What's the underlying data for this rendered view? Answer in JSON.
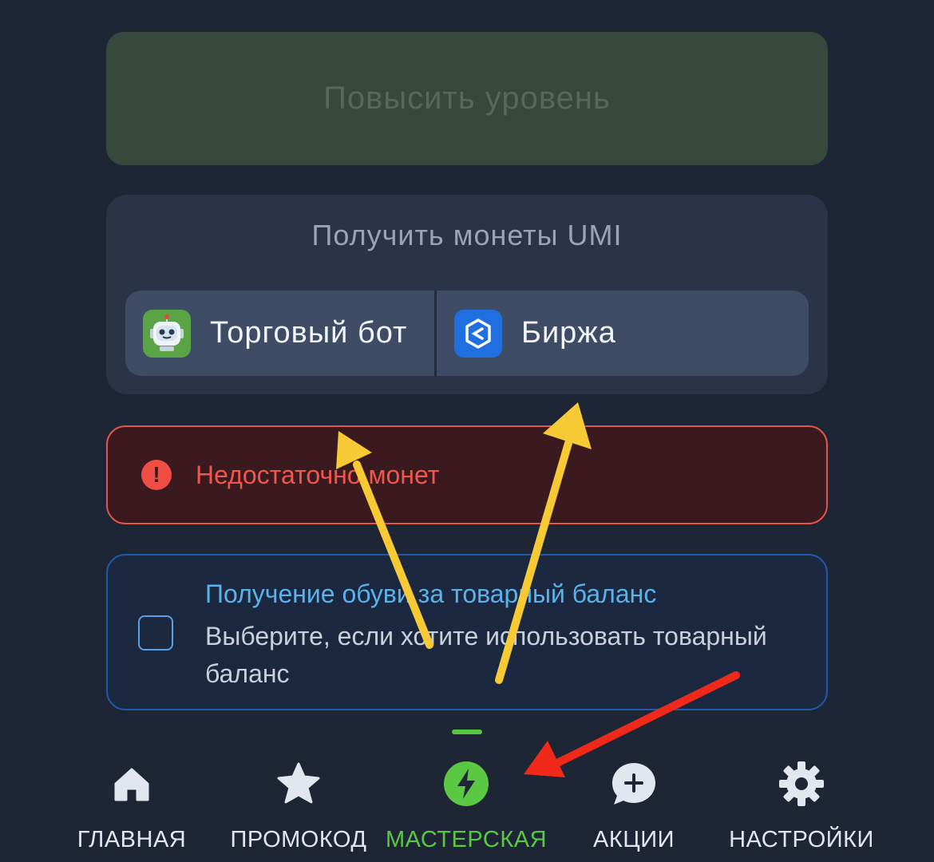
{
  "level_button": {
    "label": "Повысить уровень"
  },
  "coins_card": {
    "title": "Получить монеты UMI",
    "options": [
      {
        "label": "Торговый бот",
        "icon": "robot-icon"
      },
      {
        "label": "Биржа",
        "icon": "exchange-icon"
      }
    ]
  },
  "error": {
    "message": "Недостаточно монет",
    "icon": "exclamation-icon"
  },
  "balance_option": {
    "title": "Получение обуви за товарный баланс",
    "description": "Выберите, если хотите использовать товарный баланс",
    "checked": false
  },
  "nav": {
    "items": [
      {
        "label": "ГЛАВНАЯ",
        "icon": "home-icon",
        "active": false
      },
      {
        "label": "ПРОМОКОД",
        "icon": "star-icon",
        "active": false
      },
      {
        "label": "МАСТЕРСКАЯ",
        "icon": "lightning-icon",
        "active": true
      },
      {
        "label": "АКЦИИ",
        "icon": "chat-plus-icon",
        "active": false
      },
      {
        "label": "НАСТРОЙКИ",
        "icon": "gear-icon",
        "active": false
      }
    ]
  },
  "colors": {
    "background": "#1e2636",
    "accent_green": "#5ac842",
    "error_red": "#f0574c",
    "link_blue": "#5bb1ea",
    "annotation_yellow": "#f7c935",
    "annotation_red": "#f0291a"
  }
}
